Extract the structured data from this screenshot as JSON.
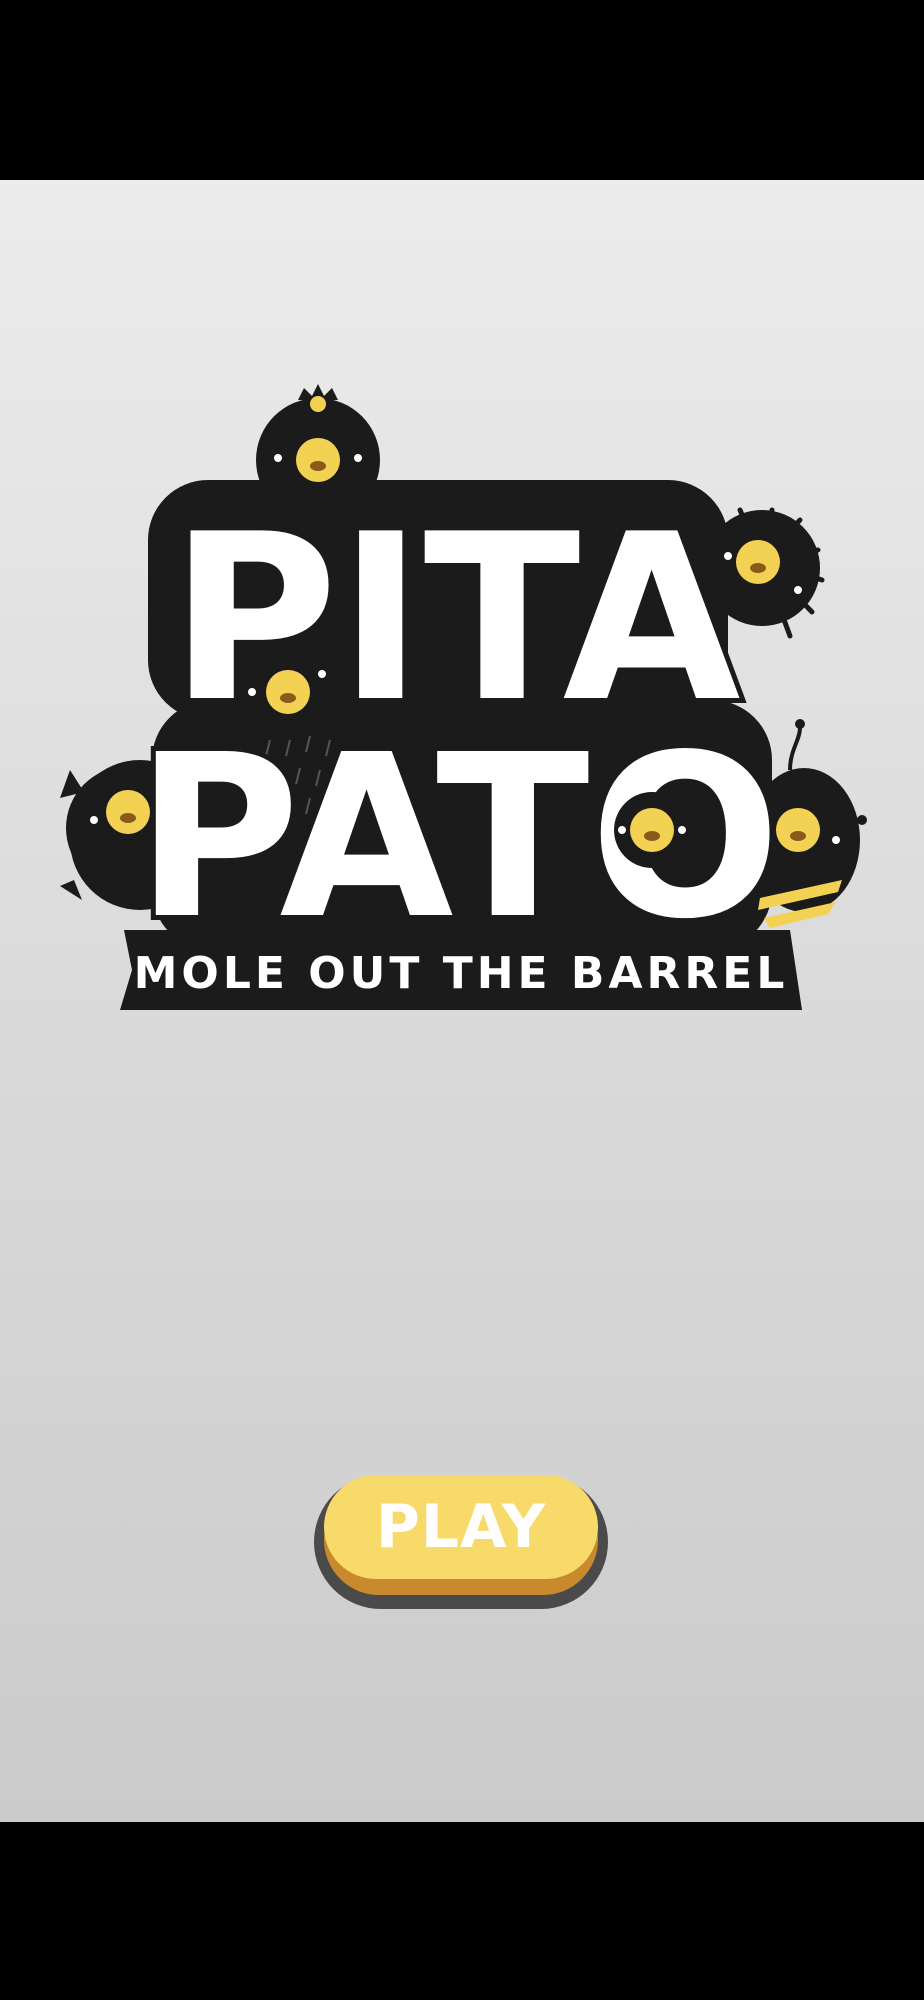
{
  "game": {
    "title_line1": "PITA",
    "title_line2": "PATO",
    "subtitle": "MOLE OUT THE BARREL",
    "play_label": "PLAY"
  },
  "colors": {
    "background_top": "#ececec",
    "background_bottom": "#cbcbcb",
    "logo_dark": "#1b1b1b",
    "creature_eye_yellow": "#f3d152",
    "play_yellow": "#f7da6a",
    "play_orange_edge": "#c98a2e"
  },
  "icons": {
    "mascots": [
      "crowned-mole-icon",
      "spiky-mole-icon",
      "eared-mole-icon",
      "horned-mole-icon",
      "bee-mole-icon",
      "barrel-eye-icon"
    ]
  }
}
